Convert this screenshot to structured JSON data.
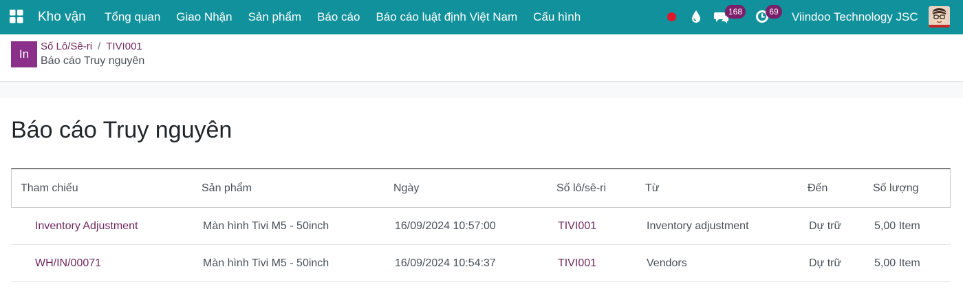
{
  "navbar": {
    "brand": "Kho vận",
    "menu": [
      "Tổng quan",
      "Giao Nhận",
      "Sản phẩm",
      "Báo cáo",
      "Báo cáo luật định Việt Nam",
      "Cấu hình"
    ],
    "messages_count": "168",
    "activities_count": "69",
    "company": "Viindoo Technology JSC",
    "icons": [
      "apps-icon",
      "record-dot-icon",
      "droplet-icon",
      "chat-icon",
      "activity-clock-icon",
      "user-avatar"
    ]
  },
  "breadcrumb": {
    "badge": "In",
    "parent": "Số Lô/Sê-ri",
    "separator": "/",
    "lot": "TIVI001",
    "current": "Báo cáo Truy nguyên"
  },
  "report": {
    "title": "Báo cáo Truy nguyên",
    "columns": [
      "Tham chiếu",
      "Sản phẩm",
      "Ngày",
      "Số lô/sê-ri",
      "Từ",
      "Đến",
      "Số lượng"
    ],
    "rows": [
      [
        "Inventory Adjustment",
        "Màn hình Tivi M5 - 50inch",
        "16/09/2024 10:57:00",
        "TIVI001",
        "Inventory adjustment",
        "Dự trữ",
        "5,00 Item"
      ],
      [
        "WH/IN/00071",
        "Màn hình Tivi M5 - 50inch",
        "16/09/2024 10:54:37",
        "TIVI001",
        "Vendors",
        "Dự trữ",
        "5,00 Item"
      ]
    ]
  },
  "colors": {
    "navbar": "#10919b",
    "link": "#71295f",
    "badge": "#7c1f6a",
    "breadcrumb_badge": "#8a2f8a",
    "record_dot": "#e0162b"
  }
}
